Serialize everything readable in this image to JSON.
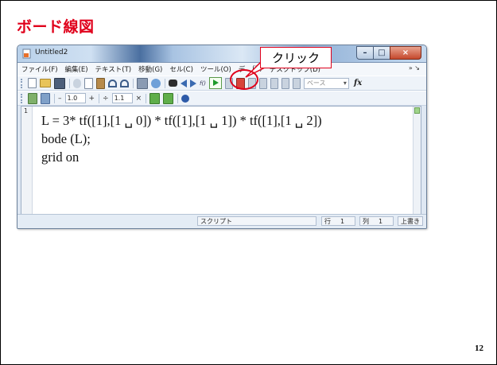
{
  "slide": {
    "title": "ボード線図",
    "page_number": "12"
  },
  "window": {
    "title": "Untitled2",
    "menu": [
      "ファイル(F)",
      "編集(E)",
      "テキスト(T)",
      "移動(G)",
      "セル(C)",
      "ツール(O)",
      "デ",
      "(B)",
      "デスクトップ(D)"
    ],
    "menu_overflow": "» ↘",
    "controls": {
      "minimize": "–",
      "maximize": "□",
      "close": "×"
    }
  },
  "toolbar1": {
    "combo_placeholder": "ベース",
    "fx_label": "fx",
    "fn_label": "f()",
    "icons": [
      "new-file-icon",
      "open-folder-icon",
      "save-icon",
      "cut-icon",
      "copy-icon",
      "paste-icon",
      "undo-icon",
      "redo-icon",
      "print-icon",
      "find-icon",
      "back-icon",
      "forward-icon",
      "run-icon",
      "breakpoint-icon",
      "clear-breakpoint-icon",
      "step-icon",
      "step-in-icon",
      "step-out-icon",
      "exit-debug-icon"
    ]
  },
  "toolbar2": {
    "minus": "–",
    "value1": "1.0",
    "plus": "+",
    "divide": "÷",
    "value2": "1.1",
    "times": "×"
  },
  "editor": {
    "line_number": "1",
    "code_lines": [
      "L = 3* tf([1],[1 ␣ 0]) * tf([1],[1 ␣ 1]) * tf([1],[1 ␣ 2])",
      "bode (L);",
      "grid on"
    ]
  },
  "statusbar": {
    "mode": "スクリプト",
    "row_label": "行",
    "row": "1",
    "col_label": "列",
    "col": "1",
    "overwrite": "上書き"
  },
  "callout": {
    "text": "クリック"
  },
  "colors": {
    "accent_red": "#e0001b",
    "run_green": "#1e9a2a"
  }
}
